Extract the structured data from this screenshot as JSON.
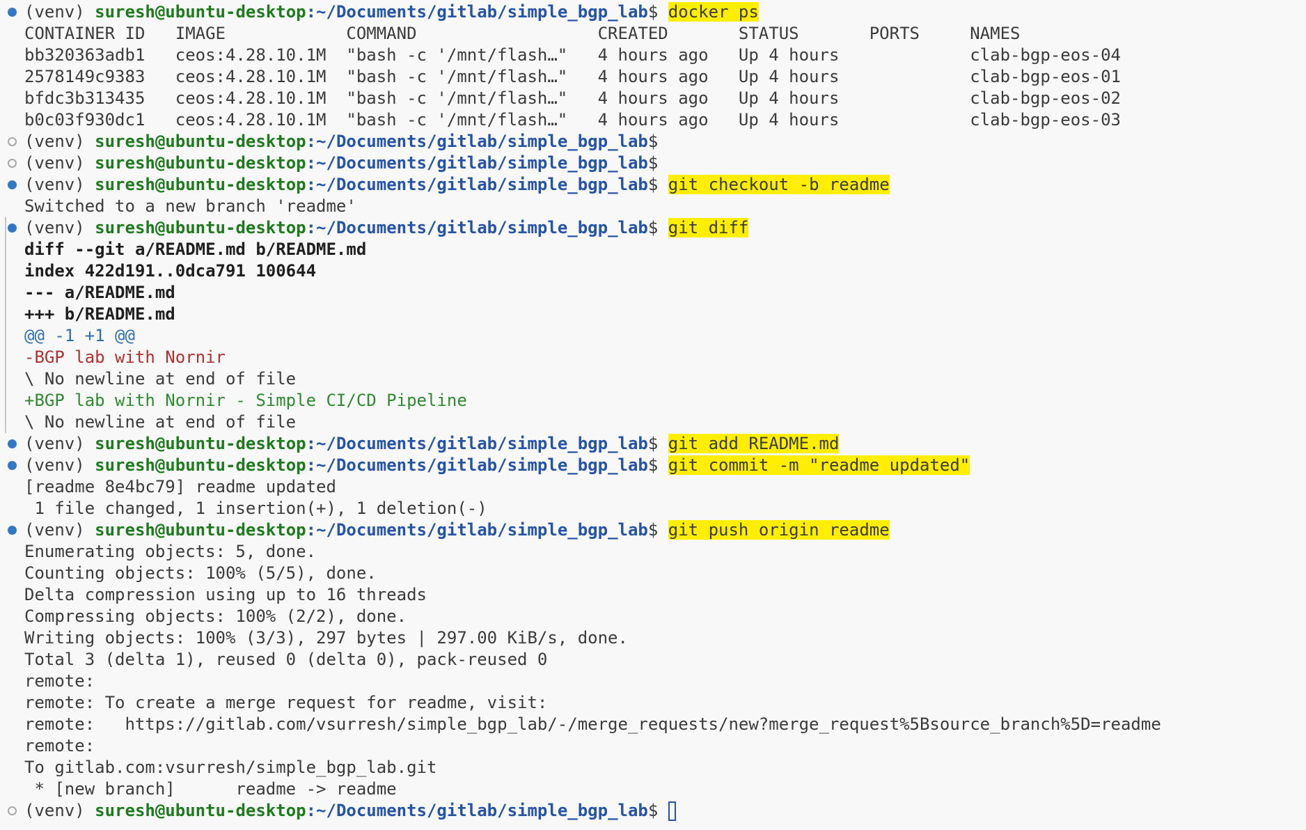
{
  "prompt": {
    "venv": "(venv) ",
    "user": "suresh@ubuntu-desktop",
    "path": ":~/Documents/gitlab/simple_bgp_lab",
    "symbol": "$"
  },
  "lines": [
    {
      "type": "prompt",
      "marker": "filled",
      "cmd": "docker ps"
    },
    {
      "type": "output",
      "text": "CONTAINER ID   IMAGE            COMMAND                  CREATED       STATUS       PORTS     NAMES"
    },
    {
      "type": "output",
      "text": "bb320363adb1   ceos:4.28.10.1M  \"bash -c '/mnt/flash…\"   4 hours ago   Up 4 hours             clab-bgp-eos-04"
    },
    {
      "type": "output",
      "text": "2578149c9383   ceos:4.28.10.1M  \"bash -c '/mnt/flash…\"   4 hours ago   Up 4 hours             clab-bgp-eos-01"
    },
    {
      "type": "output",
      "text": "bfdc3b313435   ceos:4.28.10.1M  \"bash -c '/mnt/flash…\"   4 hours ago   Up 4 hours             clab-bgp-eos-02"
    },
    {
      "type": "output",
      "text": "b0c03f930dc1   ceos:4.28.10.1M  \"bash -c '/mnt/flash…\"   4 hours ago   Up 4 hours             clab-bgp-eos-03"
    },
    {
      "type": "prompt",
      "marker": "hollow",
      "cmd": ""
    },
    {
      "type": "prompt",
      "marker": "hollow",
      "cmd": ""
    },
    {
      "type": "prompt",
      "marker": "filled",
      "cmd": "git checkout -b readme"
    },
    {
      "type": "output",
      "text": "Switched to a new branch 'readme'"
    },
    {
      "type": "prompt",
      "marker": "filled",
      "bar": true,
      "cmd": "git diff"
    },
    {
      "type": "output",
      "style": "bold",
      "bar": true,
      "text": "diff --git a/README.md b/README.md"
    },
    {
      "type": "output",
      "style": "bold",
      "bar": true,
      "text": "index 422d191..0dca791 100644"
    },
    {
      "type": "output",
      "style": "bold",
      "bar": true,
      "text": "--- a/README.md"
    },
    {
      "type": "output",
      "style": "bold",
      "bar": true,
      "text": "+++ b/README.md"
    },
    {
      "type": "output",
      "style": "hunk",
      "bar": true,
      "text": "@@ -1 +1 @@"
    },
    {
      "type": "output",
      "style": "del",
      "bar": true,
      "text": "-BGP lab with Nornir"
    },
    {
      "type": "output",
      "bar": true,
      "text": "\\ No newline at end of file"
    },
    {
      "type": "output",
      "style": "add",
      "bar": true,
      "text": "+BGP lab with Nornir - Simple CI/CD Pipeline"
    },
    {
      "type": "output",
      "bar": true,
      "text": "\\ No newline at end of file"
    },
    {
      "type": "prompt",
      "marker": "filled",
      "cmd": "git add README.md"
    },
    {
      "type": "prompt",
      "marker": "filled",
      "cmd": "git commit -m \"readme updated\""
    },
    {
      "type": "output",
      "text": "[readme 8e4bc79] readme updated"
    },
    {
      "type": "output",
      "text": " 1 file changed, 1 insertion(+), 1 deletion(-)"
    },
    {
      "type": "prompt",
      "marker": "filled",
      "cmd": "git push origin readme"
    },
    {
      "type": "output",
      "text": "Enumerating objects: 5, done."
    },
    {
      "type": "output",
      "text": "Counting objects: 100% (5/5), done."
    },
    {
      "type": "output",
      "text": "Delta compression using up to 16 threads"
    },
    {
      "type": "output",
      "text": "Compressing objects: 100% (2/2), done."
    },
    {
      "type": "output",
      "text": "Writing objects: 100% (3/3), 297 bytes | 297.00 KiB/s, done."
    },
    {
      "type": "output",
      "text": "Total 3 (delta 1), reused 0 (delta 0), pack-reused 0"
    },
    {
      "type": "output",
      "text": "remote:"
    },
    {
      "type": "output",
      "text": "remote: To create a merge request for readme, visit:"
    },
    {
      "type": "output",
      "text": "remote:   https://gitlab.com/vsurresh/simple_bgp_lab/-/merge_requests/new?merge_request%5Bsource_branch%5D=readme"
    },
    {
      "type": "output",
      "text": "remote:"
    },
    {
      "type": "output",
      "text": "To gitlab.com:vsurresh/simple_bgp_lab.git"
    },
    {
      "type": "output",
      "text": " * [new branch]      readme -> readme"
    },
    {
      "type": "prompt",
      "marker": "hollow",
      "cmd": "",
      "cursor": true
    }
  ]
}
